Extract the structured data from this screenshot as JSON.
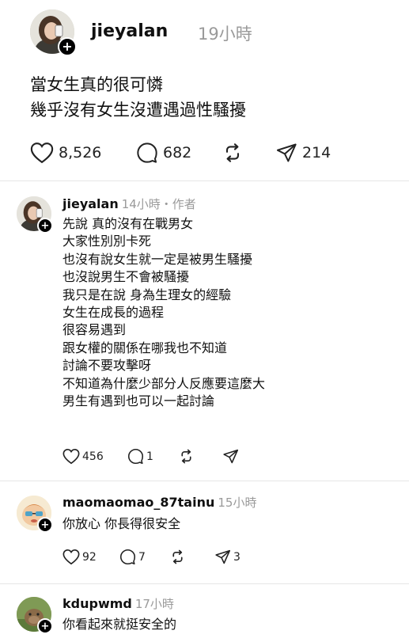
{
  "post": {
    "author": "jieyalan",
    "time": "19小時",
    "text_lines": [
      "當女生真的很可憐",
      "幾乎沒有女生沒遭遇過性騷擾"
    ],
    "likes": "8,526",
    "comments": "682",
    "reposts": "",
    "shares": "214"
  },
  "replies": [
    {
      "author": "jieyalan",
      "meta": "14小時・作者",
      "lines": [
        "先說 真的沒有在戰男女",
        "大家性別別卡死",
        "也沒有說女生就一定是被男生騷擾",
        "也沒說男生不會被騷擾",
        "我只是在說 身為生理女的經驗",
        "女生在成長的過程",
        "很容易遇到",
        "跟女權的關係在哪我也不知道",
        "討論不要攻擊呀",
        "不知道為什麼少部分人反應要這麼大",
        "男生有遇到也可以一起討論"
      ],
      "likes": "456",
      "comments": "1",
      "shares": ""
    },
    {
      "author": "maomaomao_87tainu",
      "meta": "15小時",
      "lines": [
        "你放心 你長得很安全"
      ],
      "likes": "92",
      "comments": "7",
      "shares": "3"
    },
    {
      "author": "kdupwmd",
      "meta": "17小時",
      "lines": [
        "你看起來就挺安全的"
      ]
    }
  ],
  "icons": {
    "like": "heart-icon",
    "comment": "speech-bubble-icon",
    "repost": "repost-arrows-icon",
    "share": "paper-plane-icon",
    "follow": "plus-icon"
  },
  "colors": {
    "text": "#101010",
    "muted": "#9a9a9a",
    "divider": "#e6e6e6"
  }
}
